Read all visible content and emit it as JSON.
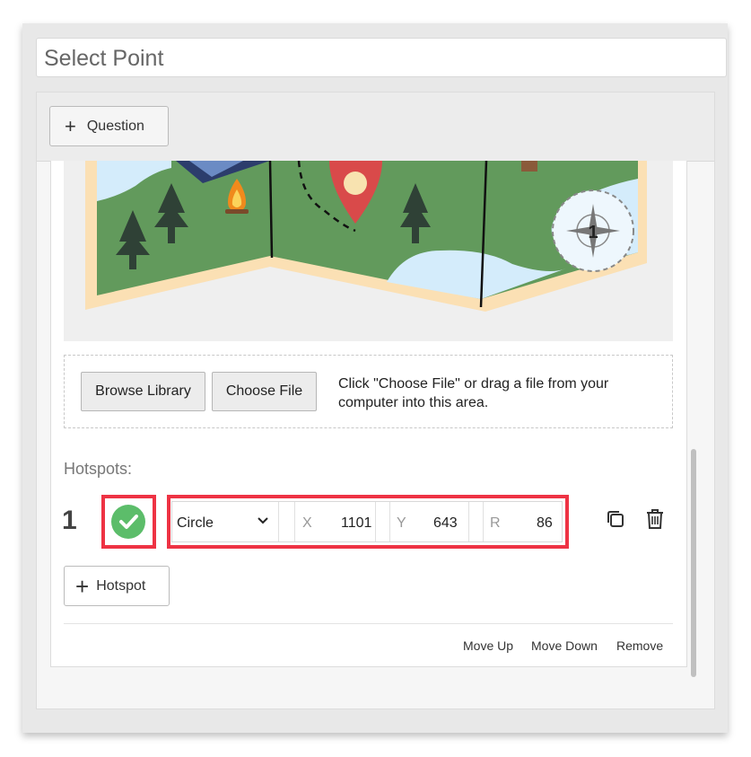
{
  "header": {
    "title_value": "Select Point"
  },
  "toolbar": {
    "add_question_label": "Question"
  },
  "map": {
    "compass_label": "1",
    "colors": {
      "land": "#629a5c",
      "water": "#d4ecfb",
      "border": "#fbe0b4",
      "pin": "#d94a4a",
      "tree": "#2f4136"
    }
  },
  "upload": {
    "browse_label": "Browse Library",
    "choose_label": "Choose File",
    "hint": "Click \"Choose File\" or drag a file from your computer into this area."
  },
  "hotspots": {
    "label": "Hotspots:",
    "items": [
      {
        "number": "1",
        "shape": "Circle",
        "x_label": "X",
        "x_value": "1101",
        "y_label": "Y",
        "y_value": "643",
        "r_label": "R",
        "r_value": "86"
      }
    ],
    "add_label": "Hotspot"
  },
  "footer": {
    "move_up": "Move Up",
    "move_down": "Move Down",
    "remove": "Remove"
  },
  "colors": {
    "highlight": "#ee3344",
    "check": "#5cbd6a"
  }
}
